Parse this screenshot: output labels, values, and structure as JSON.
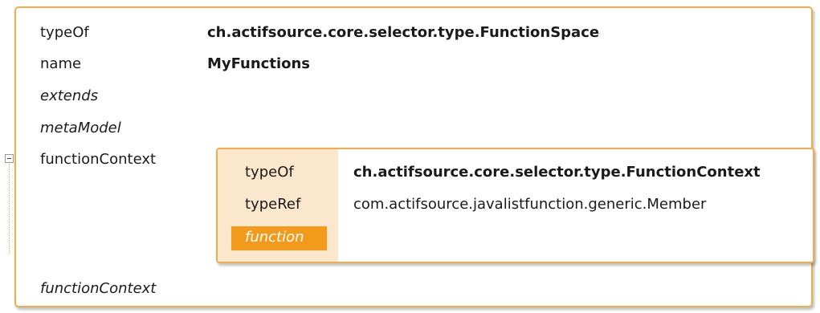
{
  "function_space": {
    "rows": [
      {
        "label": "typeOf",
        "value": "ch.actifsource.core.selector.type.FunctionSpace"
      },
      {
        "label": "name",
        "value": "MyFunctions"
      },
      {
        "label": "extends"
      },
      {
        "label": "metaModel"
      },
      {
        "label": "functionContext"
      }
    ],
    "trailing_label": "functionContext"
  },
  "function_context": {
    "rows": [
      {
        "label": "typeOf",
        "value": "ch.actifsource.core.selector.type.FunctionContext"
      },
      {
        "label": "typeRef",
        "value": "com.actifsource.javalistfunction.generic.Member"
      },
      {
        "label": "function"
      }
    ]
  },
  "colors": {
    "accent": "#f0ad4e",
    "highlight": "#f39a1d",
    "panel_left": "#fbe8cc"
  },
  "icons": {
    "collapse": "collapse-minus-icon"
  }
}
